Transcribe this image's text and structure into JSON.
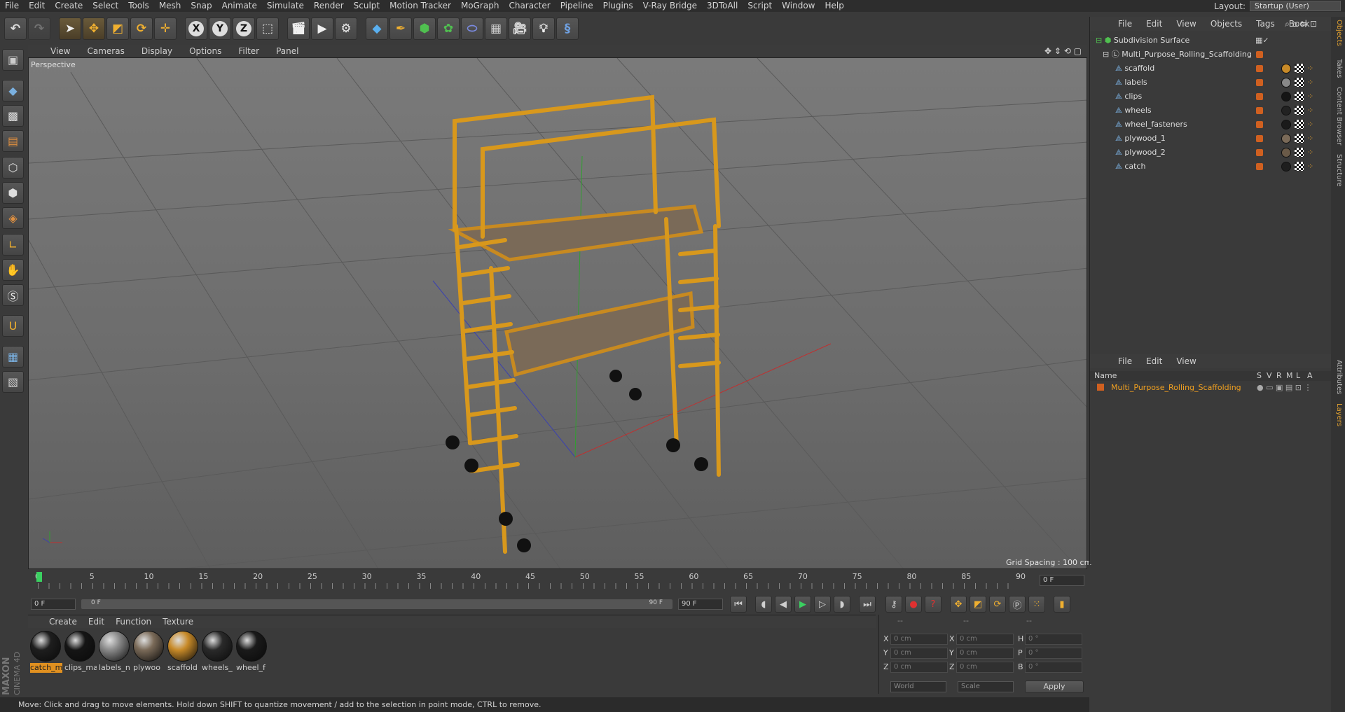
{
  "menu": [
    "File",
    "Edit",
    "Create",
    "Select",
    "Tools",
    "Mesh",
    "Snap",
    "Animate",
    "Simulate",
    "Render",
    "Sculpt",
    "Motion Tracker",
    "MoGraph",
    "Character",
    "Pipeline",
    "Plugins",
    "V-Ray Bridge",
    "3DToAll",
    "Script",
    "Window",
    "Help"
  ],
  "layout": {
    "label": "Layout:",
    "value": "Startup (User)"
  },
  "toolbar": {
    "axis_x": "X",
    "axis_y": "Y",
    "axis_z": "Z"
  },
  "viewport": {
    "menu": [
      "View",
      "Cameras",
      "Display",
      "Options",
      "Filter",
      "Panel"
    ],
    "label": "Perspective",
    "grid_spacing": "Grid Spacing : 100 cm"
  },
  "objects": {
    "menu": [
      "File",
      "Edit",
      "View",
      "Objects",
      "Tags",
      "Book"
    ],
    "root": "Subdivision Surface",
    "group": "Multi_Purpose_Rolling_Scaffolding",
    "items": [
      "scaffold",
      "labels",
      "clips",
      "wheels",
      "wheel_fasteners",
      "plywood_1",
      "plywood_2",
      "catch"
    ]
  },
  "layers": {
    "menu": [
      "File",
      "Edit",
      "View"
    ],
    "col_name": "Name",
    "cols": [
      "S",
      "V",
      "R",
      "M",
      "L",
      "A"
    ],
    "row": "Multi_Purpose_Rolling_Scaffolding"
  },
  "side_tabs": [
    "Objects",
    "Takes",
    "Content Browser",
    "Structure",
    "Attributes",
    "Layers"
  ],
  "timeline": {
    "ticks": [
      "0",
      "5",
      "10",
      "15",
      "20",
      "25",
      "30",
      "35",
      "40",
      "45",
      "50",
      "55",
      "60",
      "65",
      "70",
      "75",
      "80",
      "85",
      "90"
    ],
    "current": "0 F",
    "start": "0 F",
    "range_start": "0 F",
    "range_end": "90 F",
    "end": "90 F"
  },
  "materials": {
    "menu": [
      "Create",
      "Edit",
      "Function",
      "Texture"
    ],
    "items": [
      {
        "label": "catch_m",
        "color": "#1e1e1e"
      },
      {
        "label": "clips_ma",
        "color": "#151515"
      },
      {
        "label": "labels_n",
        "color": "#8a8a8a"
      },
      {
        "label": "plywoo",
        "color": "#7a6a58"
      },
      {
        "label": "scaffold",
        "color": "#c88a28"
      },
      {
        "label": "wheels_",
        "color": "#2a2a2a"
      },
      {
        "label": "wheel_f",
        "color": "#1a1a1a"
      }
    ]
  },
  "coords": {
    "hdr1": "--",
    "hdr2": "--",
    "hdr3": "--",
    "pos": [
      {
        "axis": "X",
        "val": "0 cm"
      },
      {
        "axis": "Y",
        "val": "0 cm"
      },
      {
        "axis": "Z",
        "val": "0 cm"
      }
    ],
    "size": [
      {
        "axis": "X",
        "val": "0 cm"
      },
      {
        "axis": "Y",
        "val": "0 cm"
      },
      {
        "axis": "Z",
        "val": "0 cm"
      }
    ],
    "rot": [
      {
        "axis": "H",
        "val": "0 °"
      },
      {
        "axis": "P",
        "val": "0 °"
      },
      {
        "axis": "B",
        "val": "0 °"
      }
    ],
    "mode1": "World",
    "mode2": "Scale",
    "apply": "Apply"
  },
  "brand": {
    "line1": "MAXON",
    "line2": "CINEMA 4D"
  },
  "status": "Move: Click and drag to move elements. Hold down SHIFT to quantize movement / add to the selection in point mode, CTRL to remove."
}
